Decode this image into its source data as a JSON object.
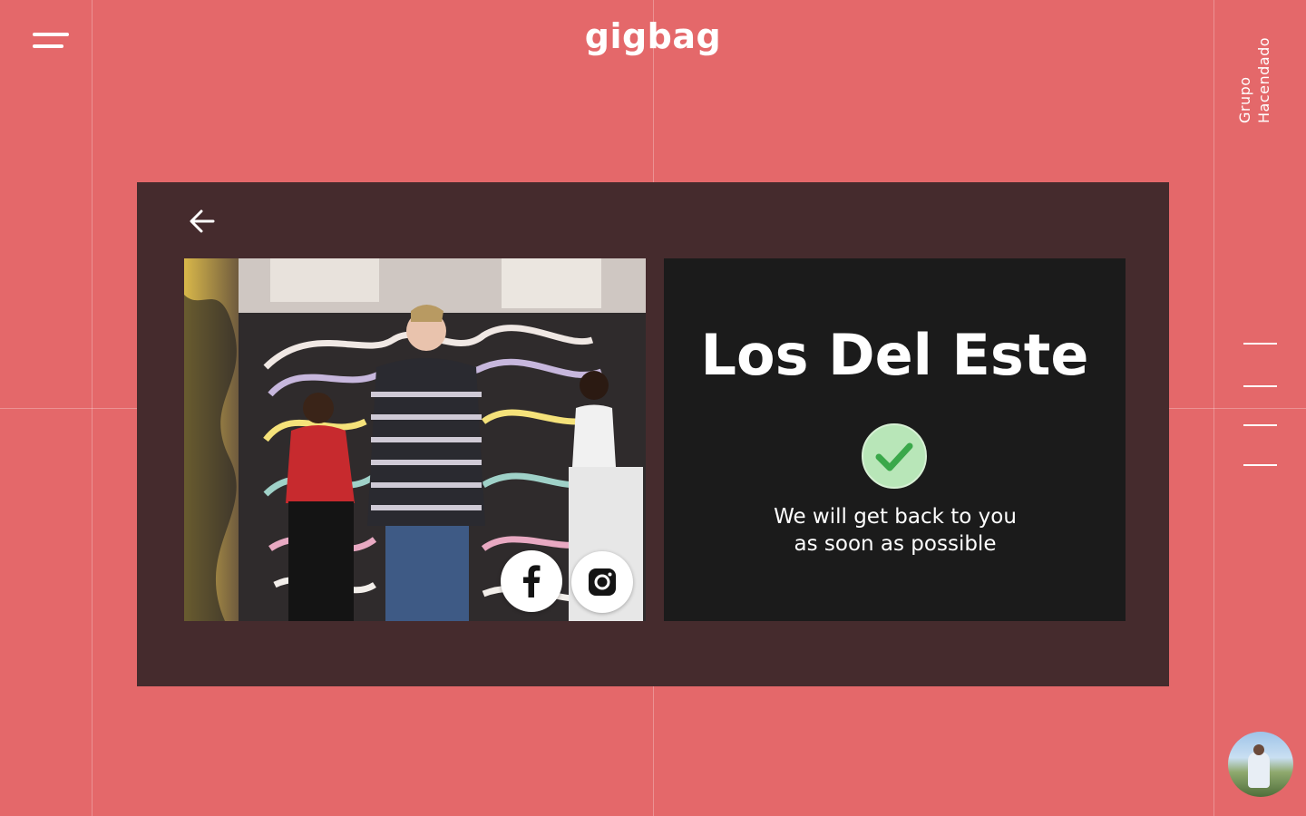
{
  "app": {
    "logo": "gigbag"
  },
  "vendor": {
    "name": "Grupo Hacendado"
  },
  "band": {
    "name": "Los Del Este",
    "message": "We will get back to you as soon as possible"
  },
  "icons": {
    "menu": "hamburger-icon",
    "back": "arrow-left-icon",
    "facebook": "facebook-icon",
    "instagram": "instagram-icon",
    "success": "checkmark-icon"
  },
  "colors": {
    "background": "#e4686a",
    "card": "#452b2d",
    "info_panel": "#1b1b1b",
    "check_fill": "#b8e6b8",
    "check_mark": "#3aa84a"
  }
}
